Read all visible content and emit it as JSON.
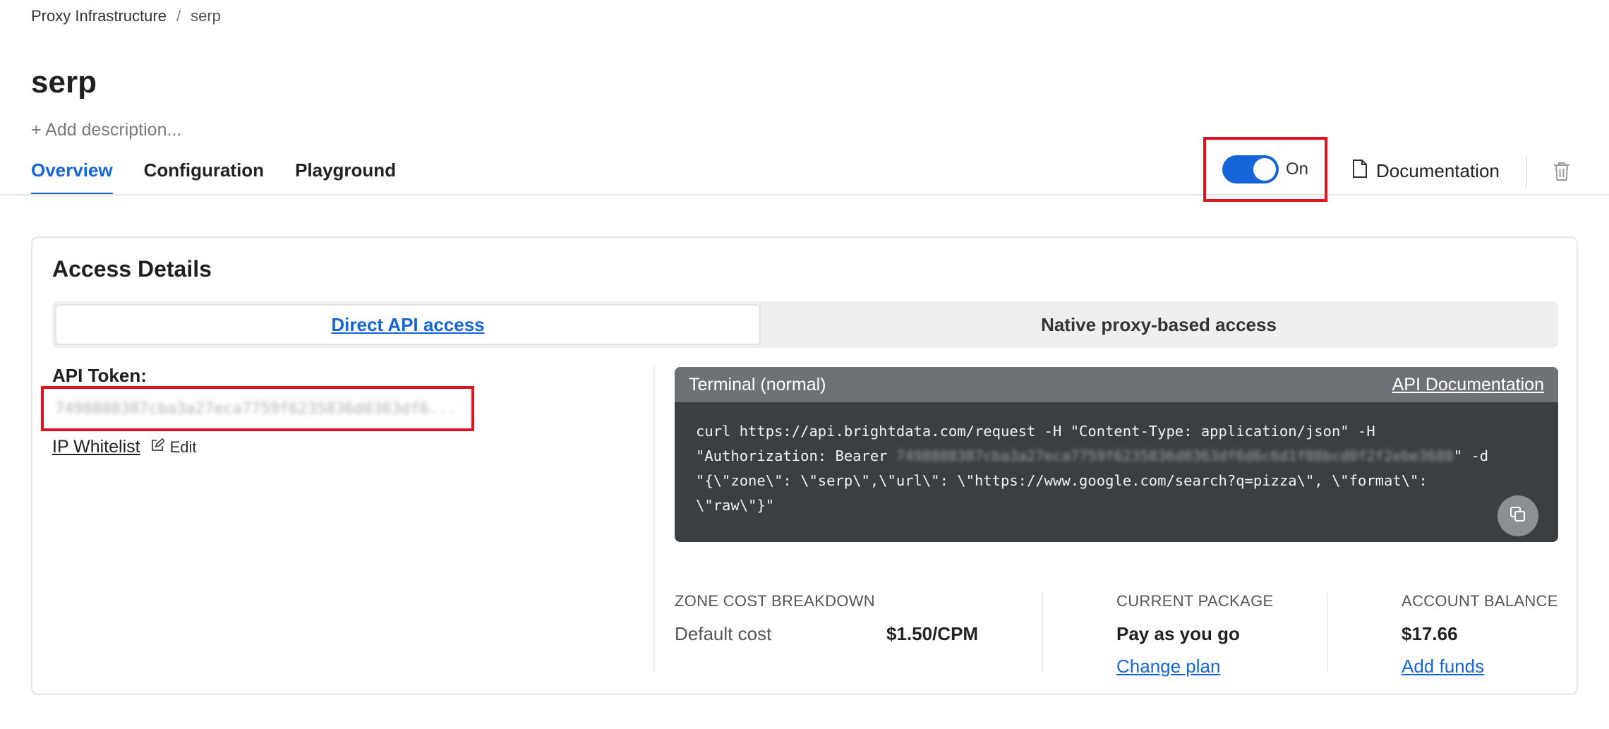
{
  "breadcrumb": {
    "root": "Proxy Infrastructure",
    "separator": "/",
    "current": "serp"
  },
  "page": {
    "title": "serp",
    "add_description": "+ Add description..."
  },
  "tabs": [
    {
      "label": "Overview",
      "active": true
    },
    {
      "label": "Configuration",
      "active": false
    },
    {
      "label": "Playground",
      "active": false
    }
  ],
  "toggle": {
    "label": "On",
    "state": true
  },
  "header_actions": {
    "documentation": "Documentation",
    "documentation_icon": "document-icon",
    "delete_icon": "trash-icon"
  },
  "access": {
    "title": "Access Details",
    "segments": [
      "Direct API access",
      "Native proxy-based access"
    ],
    "api_token_label": "API Token:",
    "api_token_value": "7498808387cba3a27eca7759f6235836d0363df6...",
    "ip_whitelist": "IP Whitelist",
    "edit": "Edit"
  },
  "terminal": {
    "title": "Terminal (normal)",
    "doc_link": "API Documentation",
    "line1": "curl https://api.brightdata.com/request -H \"Content-Type: application/json\" -H",
    "line2_prefix": "\"Authorization: Bearer ",
    "line2_token": "7498808387cba3a27eca7759f6235836d0363df6d6c6d1f08bcd0f2f2ebe3688",
    "line2_suffix": "\" -d",
    "line3": "\"{\\\"zone\\\": \\\"serp\\\",\\\"url\\\": \\\"https://www.google.com/search?q=pizza\\\", \\\"format\\\":",
    "line4": "\\\"raw\\\"}\""
  },
  "stats": {
    "zone_cost_label": "ZONE COST BREAKDOWN",
    "default_cost_label": "Default cost",
    "default_cost_value": "$1.50/CPM",
    "package_label": "CURRENT PACKAGE",
    "package_value": "Pay as you go",
    "change_plan": "Change plan",
    "balance_label": "ACCOUNT BALANCE",
    "balance_value": "$17.66",
    "add_funds": "Add funds"
  },
  "colors": {
    "accent": "#1565d8",
    "highlight": "#e0141e",
    "terminal_bg": "#3b3f42",
    "terminal_header": "#6e7276"
  }
}
